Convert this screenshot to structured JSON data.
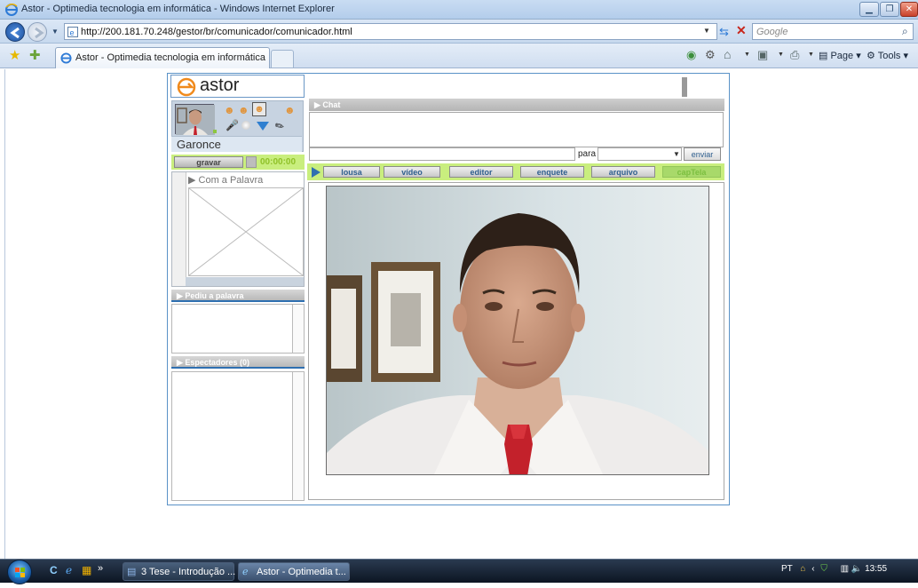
{
  "window": {
    "title": "Astor - Optimedia tecnologia em informática - Windows Internet Explorer"
  },
  "browser": {
    "url": "http://200.181.70.248/gestor/br/comunicador/comunicador.html",
    "search_placeholder": "Google",
    "tab_title": "Astor - Optimedia tecnologia em informática",
    "commands": {
      "page": "Page",
      "tools": "Tools"
    }
  },
  "app": {
    "logo": "astor",
    "user_name": "Garonce",
    "record": {
      "button": "gravar",
      "time": "00:00:00"
    },
    "palavra": {
      "header": "Com a Palavra"
    },
    "pediu": {
      "header": "Pediu a palavra"
    },
    "espectadores": {
      "header": "Espectadores",
      "count": "(0)"
    },
    "chat": {
      "header": "Chat",
      "para_label": "para",
      "send": "enviar"
    },
    "menu": [
      {
        "label": "lousa"
      },
      {
        "label": "vídeo"
      },
      {
        "label": "editor"
      },
      {
        "label": "enquete"
      },
      {
        "label": "arquivo"
      },
      {
        "label": "capTela"
      }
    ]
  },
  "taskbar": {
    "items": [
      {
        "label": "3 Tese - Introdução ..."
      },
      {
        "label": "Astor - Optimedia t..."
      }
    ],
    "language": "PT",
    "clock": "13:55"
  }
}
